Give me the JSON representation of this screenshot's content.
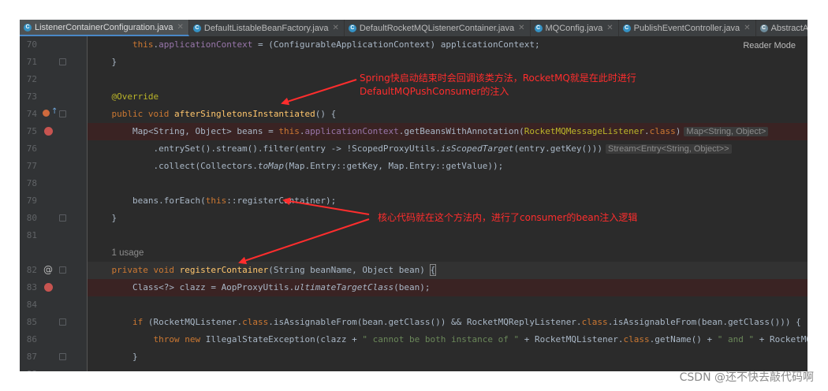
{
  "tabs": [
    {
      "label": "ListenerContainerConfiguration.java",
      "active": true,
      "closable": true
    },
    {
      "label": "DefaultListableBeanFactory.java",
      "active": false,
      "closable": true
    },
    {
      "label": "DefaultRocketMQListenerContainer.java",
      "active": false,
      "closable": true
    },
    {
      "label": "MQConfig.java",
      "active": false,
      "closable": true
    },
    {
      "label": "PublishEventController.java",
      "active": false,
      "closable": true
    },
    {
      "label": "AbstractA",
      "active": false,
      "closable": false
    }
  ],
  "reader_mode_label": "Reader Mode",
  "usage_hint": "1 usage",
  "code_lines": [
    {
      "num": "70",
      "text": "        this.applicationContext = (ConfigurableApplicationContext) applicationContext;"
    },
    {
      "num": "71",
      "text": "    }"
    },
    {
      "num": "72",
      "text": ""
    },
    {
      "num": "73",
      "text": "    @Override"
    },
    {
      "num": "74",
      "text": "    public void afterSingletonsInstantiated() {"
    },
    {
      "num": "75",
      "text": "        Map<String, Object> beans = this.applicationContext.getBeansWithAnnotation(RocketMQMessageListener.class)",
      "hint": "Map<String, Object>"
    },
    {
      "num": "76",
      "text": "            .entrySet().stream().filter(entry -> !ScopedProxyUtils.isScopedTarget(entry.getKey()))",
      "hint": "Stream<Entry<String, Object>>"
    },
    {
      "num": "77",
      "text": "            .collect(Collectors.toMap(Map.Entry::getKey, Map.Entry::getValue));"
    },
    {
      "num": "78",
      "text": ""
    },
    {
      "num": "79",
      "text": "        beans.forEach(this::registerContainer);"
    },
    {
      "num": "80",
      "text": "    }"
    },
    {
      "num": "81",
      "text": ""
    },
    {
      "num": "",
      "text": "1 usage"
    },
    {
      "num": "82",
      "text": "    private void registerContainer(String beanName, Object bean) {"
    },
    {
      "num": "83",
      "text": "        Class<?> clazz = AopProxyUtils.ultimateTargetClass(bean);"
    },
    {
      "num": "84",
      "text": ""
    },
    {
      "num": "85",
      "text": "        if (RocketMQListener.class.isAssignableFrom(bean.getClass()) && RocketMQReplyListener.class.isAssignableFrom(bean.getClass())) {"
    },
    {
      "num": "86",
      "text": "            throw new IllegalStateException(clazz + \" cannot be both instance of \" + RocketMQListener.class.getName() + \" and \" + RocketMQRepl"
    },
    {
      "num": "87",
      "text": "        }"
    },
    {
      "num": "88",
      "text": ""
    }
  ],
  "annotations": {
    "note1_line1": "Spring快启动结束时会回调该类方法，RocketMQ就是在此时进行",
    "note1_line2": "DefaultMQPushConsumer的注入",
    "note2": "核心代码就在这个方法内，进行了consumer的bean注入逻辑"
  },
  "watermark": "CSDN @还不快去敲代码啊",
  "colors": {
    "editor_bg": "#2b2b2b",
    "keyword": "#cc7832",
    "method": "#ffc66d",
    "field": "#9876aa",
    "string": "#6a8759",
    "annotation": "#bbb529",
    "breakpoint": "#c75450",
    "callout": "#ff2d2d"
  }
}
